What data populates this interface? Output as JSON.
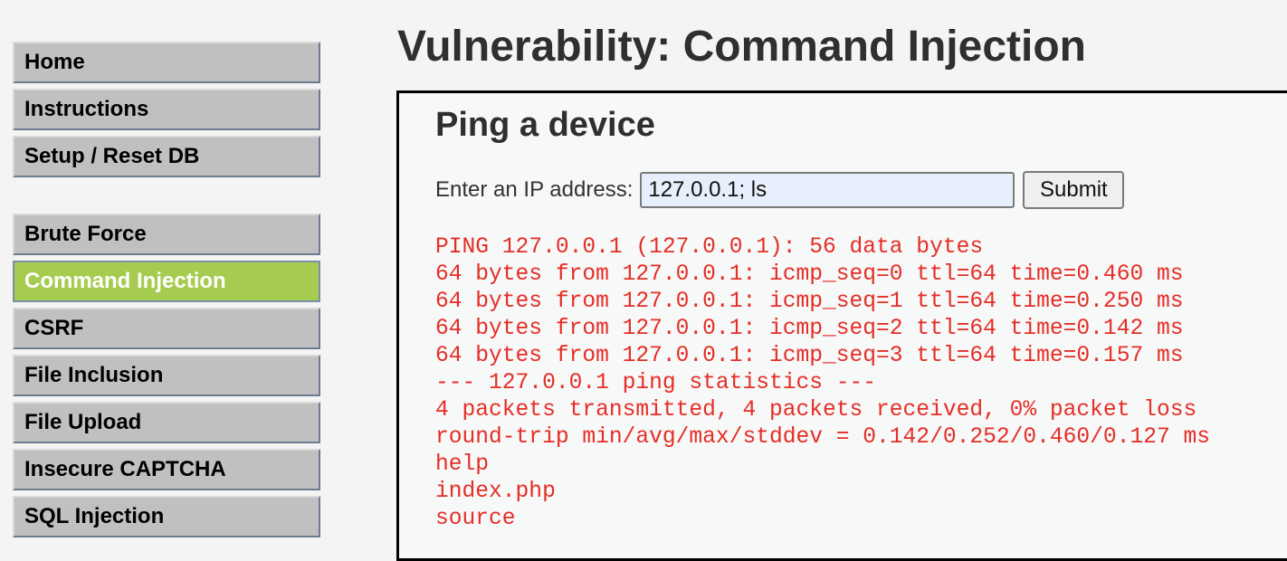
{
  "sidebar": {
    "groups": [
      {
        "items": [
          {
            "label": "Home"
          },
          {
            "label": "Instructions"
          },
          {
            "label": "Setup / Reset DB"
          }
        ]
      },
      {
        "items": [
          {
            "label": "Brute Force"
          },
          {
            "label": "Command Injection",
            "selected": true
          },
          {
            "label": "CSRF"
          },
          {
            "label": "File Inclusion"
          },
          {
            "label": "File Upload"
          },
          {
            "label": "Insecure CAPTCHA"
          },
          {
            "label": "SQL Injection"
          }
        ]
      }
    ]
  },
  "page": {
    "title": "Vulnerability: Command Injection",
    "section_title": "Ping a device",
    "form": {
      "label": "Enter an IP address:",
      "ip_value": "127.0.0.1; ls",
      "submit_label": "Submit"
    },
    "output_lines": [
      "PING 127.0.0.1 (127.0.0.1): 56 data bytes",
      "64 bytes from 127.0.0.1: icmp_seq=0 ttl=64 time=0.460 ms",
      "64 bytes from 127.0.0.1: icmp_seq=1 ttl=64 time=0.250 ms",
      "64 bytes from 127.0.0.1: icmp_seq=2 ttl=64 time=0.142 ms",
      "64 bytes from 127.0.0.1: icmp_seq=3 ttl=64 time=0.157 ms",
      "--- 127.0.0.1 ping statistics ---",
      "4 packets transmitted, 4 packets received, 0% packet loss",
      "round-trip min/avg/max/stddev = 0.142/0.252/0.460/0.127 ms",
      "help",
      "index.php",
      "source"
    ]
  },
  "colors": {
    "menu_bg": "#c0c0c0",
    "menu_selected_bg": "#a6cc4f",
    "output_text": "#e52e26",
    "input_bg": "#e8effc"
  }
}
